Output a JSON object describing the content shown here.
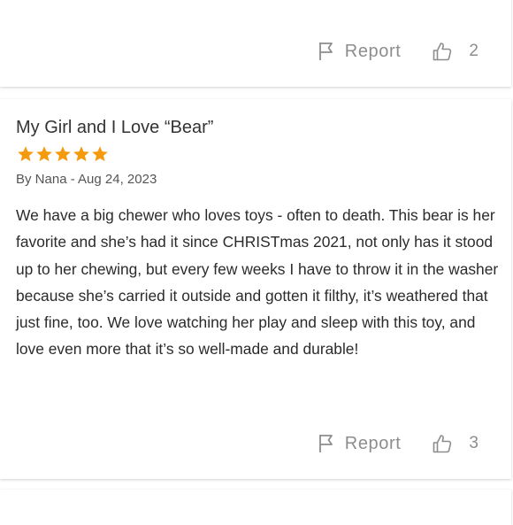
{
  "previous_review": {
    "report_label": "Report",
    "like_count": "2"
  },
  "review": {
    "title": "My Girl and I Love “Bear”",
    "rating": 5,
    "byline": "By Nana - Aug 24, 2023",
    "body": "We have a big chewer who loves toys - often to death.  This bear is her favorite and she’s had it since CHRISTmas 2021, not only has it stood up to her chewing, but every few weeks I have to throw it in the washer because she’s carried it outside and gotten it filthy, it’s weathered that just fine, too.  We love watching her play and sleep with this toy, and love even more that it’s so well-made and durable!",
    "report_label": "Report",
    "like_count": "3"
  },
  "icons": {
    "report": "flag-icon",
    "like": "thumbs-up-icon",
    "star": "star-icon"
  },
  "colors": {
    "star": "#f59a0c",
    "muted_text": "#8d8d8d",
    "title_text": "#333333"
  }
}
